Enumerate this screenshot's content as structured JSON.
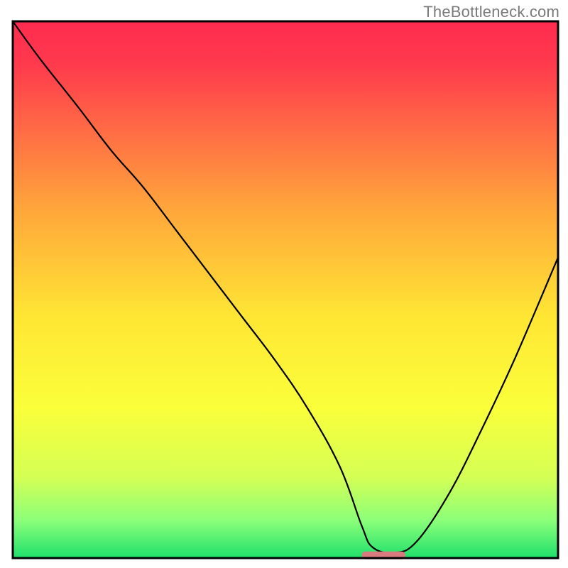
{
  "watermark": "TheBottleneck.com",
  "chart_data": {
    "type": "line",
    "title": "",
    "xlabel": "",
    "ylabel": "",
    "xlim": [
      0,
      100
    ],
    "ylim": [
      0,
      100
    ],
    "series": [
      {
        "name": "curve",
        "x": [
          0,
          5,
          12,
          18,
          24,
          30,
          36,
          42,
          48,
          54,
          60,
          64,
          66,
          70,
          74,
          80,
          86,
          92,
          100
        ],
        "y": [
          100,
          93,
          84,
          76,
          69,
          61,
          53,
          45,
          37,
          28,
          17,
          6,
          2,
          1,
          3,
          12,
          24,
          37,
          56
        ]
      }
    ],
    "annotations": [
      {
        "name": "bar-marker",
        "x_center": 68,
        "width": 8,
        "y": 0.5,
        "color": "#d77b7f"
      }
    ],
    "gradient_stops": [
      {
        "pos": 0.0,
        "color": "#ff2b4f"
      },
      {
        "pos": 0.08,
        "color": "#ff3a4d"
      },
      {
        "pos": 0.2,
        "color": "#ff6a45"
      },
      {
        "pos": 0.35,
        "color": "#ffa63b"
      },
      {
        "pos": 0.55,
        "color": "#ffe634"
      },
      {
        "pos": 0.72,
        "color": "#faff3a"
      },
      {
        "pos": 0.85,
        "color": "#d4ff55"
      },
      {
        "pos": 0.93,
        "color": "#8bff79"
      },
      {
        "pos": 1.0,
        "color": "#1fe06b"
      }
    ],
    "frame": {
      "stroke": "#000000",
      "stroke_width": 3
    }
  }
}
